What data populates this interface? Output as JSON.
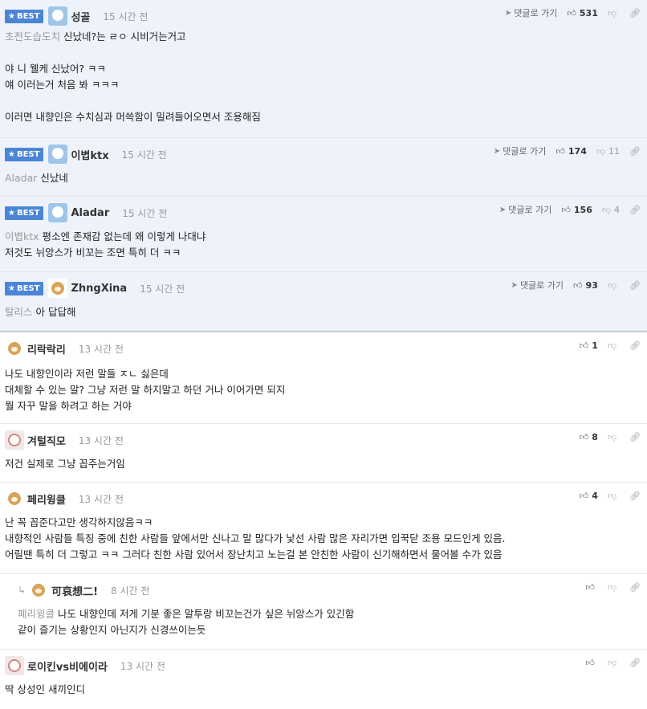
{
  "best_label": "BEST",
  "reply_label": "댓글로 가기",
  "best_comments": [
    {
      "nick": "성골",
      "time": "15 시간 전",
      "up": "531",
      "down": "",
      "mention": "초전도습도치",
      "lines": [
        "신났네?는 ㄹㅇ 시비거는거고",
        "",
        "야 니 웰케 신났어? ㅋㅋ",
        "얘 이러는거 처음 봐 ㅋㅋㅋ",
        "",
        "이러면 내향인은 수치심과 머쓱함이 밀려들어오면서 조용해짐"
      ]
    },
    {
      "nick": "이볍ktx",
      "time": "15 시간 전",
      "up": "174",
      "down": "11",
      "mention": "Aladar",
      "lines": [
        "신났네"
      ]
    },
    {
      "nick": "Aladar",
      "time": "15 시간 전",
      "up": "156",
      "down": "4",
      "mention": "이볍ktx",
      "lines": [
        "평소엔 존재감 없는데 왜 이렇게 나대냐",
        "저것도 뉘앙스가 비꼬는 조면 특히 더 ㅋㅋ"
      ]
    },
    {
      "nick": "ZhngXina",
      "time": "15 시간 전",
      "up": "93",
      "down": "",
      "mention": "탈리스",
      "lines": [
        "아 답답해"
      ]
    }
  ],
  "comments": [
    {
      "nick": "리락락리",
      "time": "13 시간 전",
      "up": "1",
      "mention": "",
      "lines": [
        "나도 내향인이라 저런 말들 ㅈㄴ 싫은데",
        "대체할 수 있는 말? 그냥 저런 말 하지말고 하던 거나 이어가면 되지",
        "뭘 자꾸 말을 하려고 하는 거야"
      ]
    },
    {
      "nick": "겨털직모",
      "time": "13 시간 전",
      "up": "8",
      "mention": "",
      "lines": [
        "저건 실제로 그냥 꼽주는거임"
      ]
    },
    {
      "nick": "페리윙클",
      "time": "13 시간 전",
      "up": "4",
      "mention": "",
      "lines": [
        "난 꼭 꼽준다고만 생각하지않음ㅋㅋ",
        "내향적인 사람들 특징 중에 친한 사람들 앞에서만 신나고 말 많다가 낯선 사람 많은 자리가면 입꾹닫 조용 모드인게 있음.",
        "어릴땐 특히 더 그렇고 ㅋㅋ 그러다 친한 사람 있어서 장난치고 노는걸 본 안친한 사람이 신기해하면서 물어볼 수가 있음"
      ]
    },
    {
      "nick": "可哀想二!",
      "time": "8 시간 전",
      "up": "",
      "mention": "페리윙클",
      "lines": [
        "나도 내향인데 저게 기분 좋은 말투랑 비꼬는건가 싶은 뉘앙스가 있긴함",
        "같이 즐기는 상황인지 아닌지가 신경쓰이는듯"
      ]
    },
    {
      "nick": "로이킨vs비에이라",
      "time": "13 시간 전",
      "up": "",
      "mention": "",
      "lines": [
        "딱 상성인 새끼인디"
      ]
    }
  ],
  "icons": {
    "up": "thumbs-up-icon",
    "down": "thumbs-down-icon",
    "reply": "reply-arrow-icon",
    "link": "link-icon",
    "star": "star-icon"
  }
}
